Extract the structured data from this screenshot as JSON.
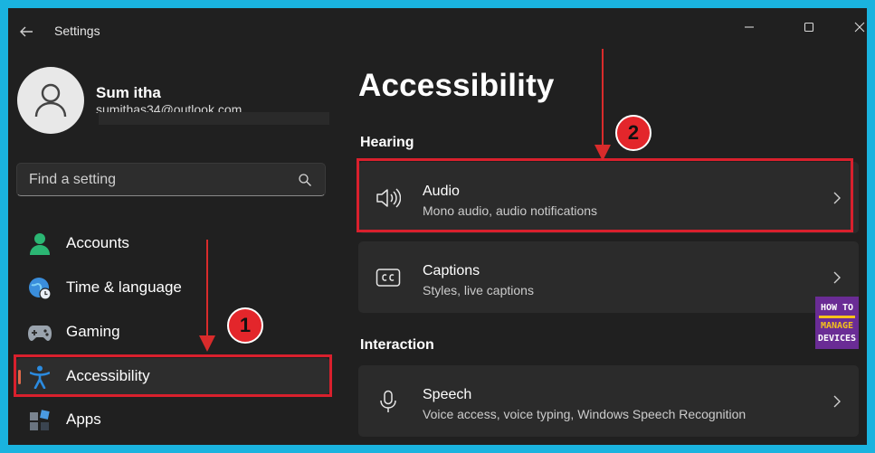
{
  "window": {
    "title": "Settings"
  },
  "profile": {
    "name": "Sum itha",
    "email": "sumithas34@outlook.com"
  },
  "search": {
    "placeholder": "Find a setting",
    "value": ""
  },
  "sidebar": {
    "items": [
      {
        "label": "Accounts",
        "icon": "accounts-icon",
        "color": "#2bb673"
      },
      {
        "label": "Time & language",
        "icon": "globe-clock-icon",
        "color": "#3a8edc"
      },
      {
        "label": "Gaming",
        "icon": "game-controller-icon",
        "color": "#9aa3ad"
      },
      {
        "label": "Accessibility",
        "icon": "accessibility-icon",
        "color": "#2b8be0",
        "selected": true
      },
      {
        "label": "Apps",
        "icon": "apps-icon",
        "color": "#4a9ae0"
      }
    ]
  },
  "main": {
    "title": "Accessibility",
    "sections": [
      {
        "header": "Hearing",
        "cards": [
          {
            "title": "Audio",
            "subtitle": "Mono audio, audio notifications",
            "icon": "speaker-icon"
          },
          {
            "title": "Captions",
            "subtitle": "Styles, live captions",
            "icon": "closed-captions-icon"
          }
        ]
      },
      {
        "header": "Interaction",
        "cards": [
          {
            "title": "Speech",
            "subtitle": "Voice access, voice typing, Windows Speech Recognition",
            "icon": "microphone-icon"
          }
        ]
      }
    ]
  },
  "annotations": {
    "badge_1": "1",
    "badge_2": "2",
    "color": "#d9202d"
  },
  "logo": {
    "line1": "HOW TO",
    "line2": "MANAGE",
    "line3": "DEVICES"
  },
  "colors": {
    "accent": "#e0694a",
    "window_bg": "#202020",
    "card_bg": "#2b2b2b",
    "frame": "#1ab3df"
  }
}
